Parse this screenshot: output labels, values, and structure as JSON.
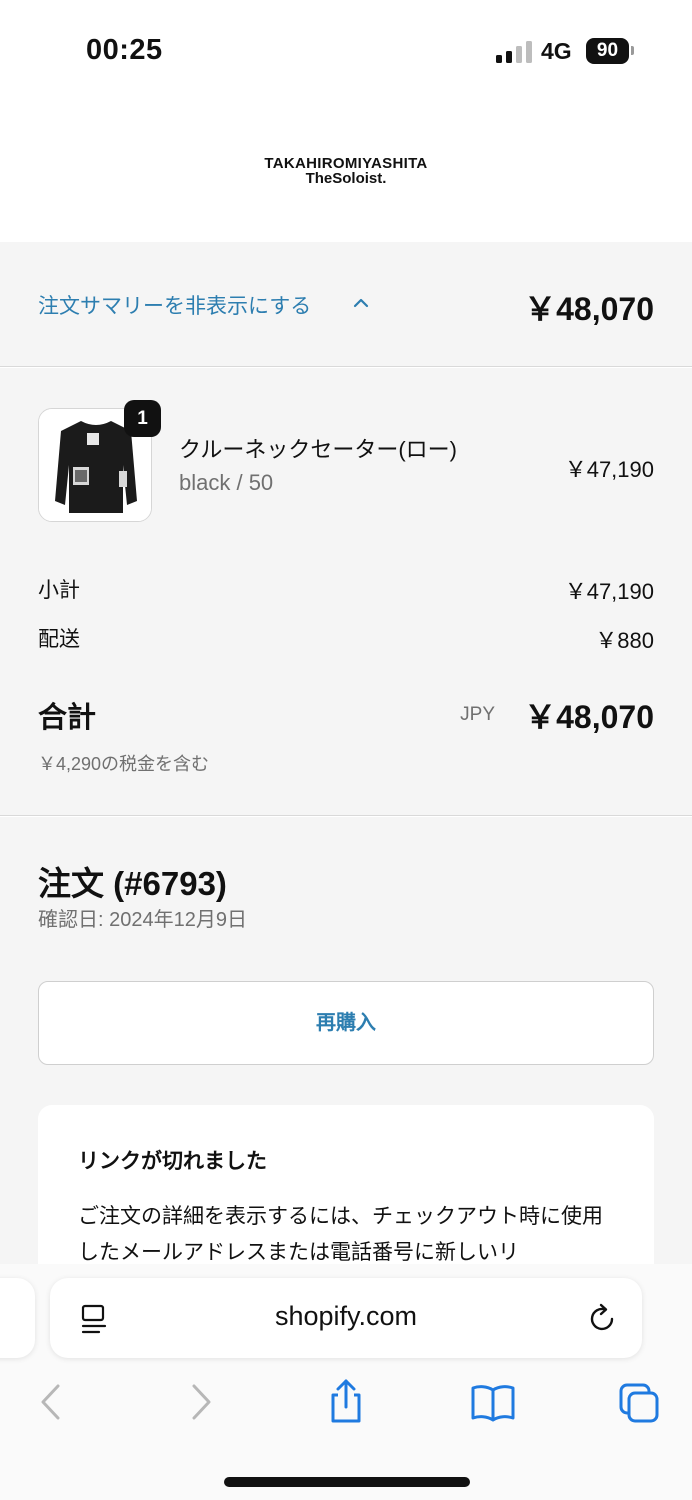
{
  "status_bar": {
    "time": "00:25",
    "network": "4G",
    "battery": "90"
  },
  "header": {
    "logo_line1": "TAKAHIROMIYASHITA",
    "logo_line2": "TheSoloist."
  },
  "summary_toggle": {
    "label": "注文サマリーを非表示にする",
    "total": "￥48,070"
  },
  "line_item": {
    "quantity": "1",
    "name": "クルーネックセーター(ロー)",
    "variant": "black / 50",
    "price": "￥47,190"
  },
  "totals": {
    "subtotal_label": "小計",
    "subtotal_value": "￥47,190",
    "shipping_label": "配送",
    "shipping_value": "￥880",
    "total_label": "合計",
    "currency": "JPY",
    "total_value": "￥48,070",
    "tax_note": "￥4,290の税金を含む"
  },
  "order": {
    "title": "注文 (#6793)",
    "date": "確認日: 2024年12月9日",
    "reorder_label": "再購入"
  },
  "notice": {
    "title": "リンクが切れました",
    "body": "ご注文の詳細を表示するには、チェックアウト時に使用したメールアドレスまたは電話番号に新しいリ"
  },
  "browser": {
    "url": "shopify.com"
  },
  "colors": {
    "accent": "#2d7eb0",
    "safari_blue": "#1f7ae0",
    "muted": "#707070",
    "panel": "#f5f5f5"
  },
  "icons": [
    "signal-icon",
    "chevron-up-icon",
    "reader-icon",
    "reload-icon",
    "back-icon",
    "forward-icon",
    "share-icon",
    "bookmarks-icon",
    "tabs-icon"
  ]
}
